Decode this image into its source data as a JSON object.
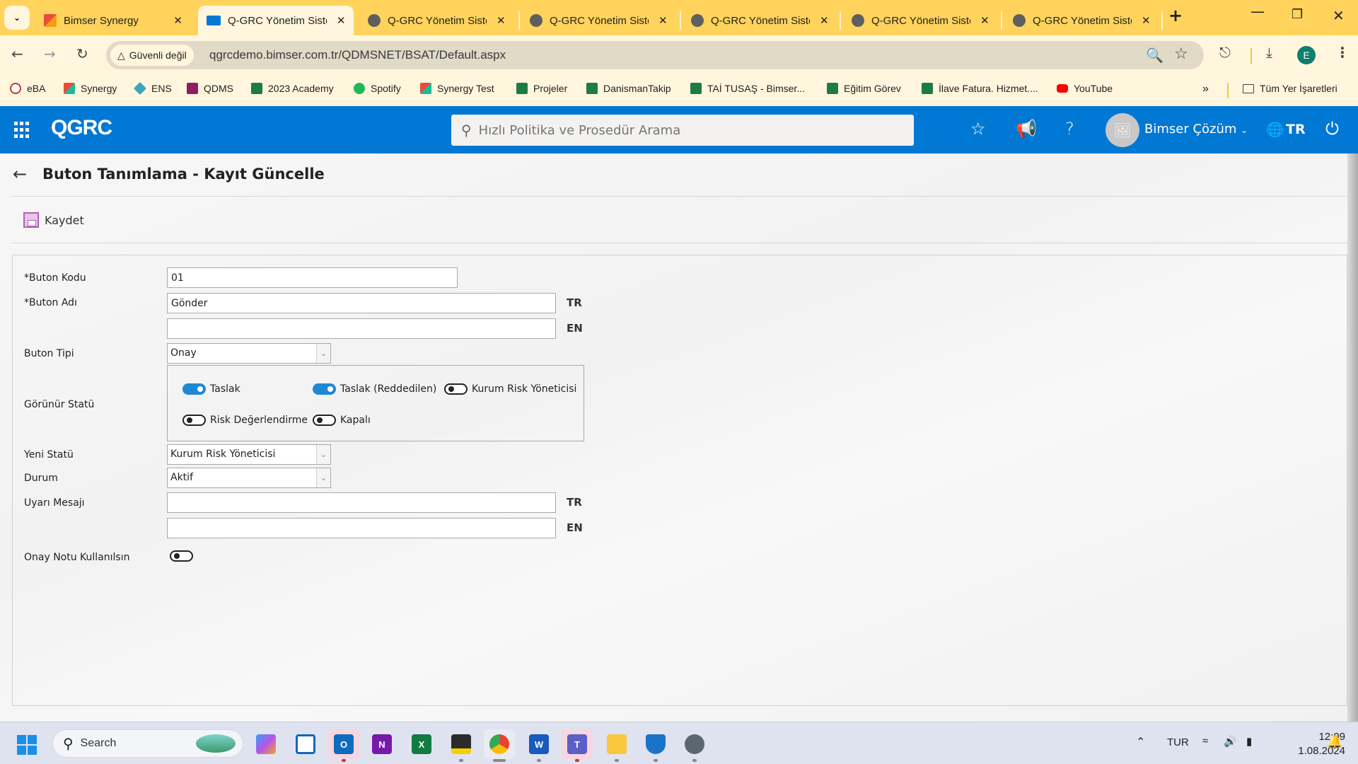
{
  "browser": {
    "tabs": [
      {
        "title": "Bimser Synergy",
        "active": false
      },
      {
        "title": "Q-GRC Yönetim Sistemi",
        "active": true
      },
      {
        "title": "Q-GRC Yönetim Sistemi",
        "active": false
      },
      {
        "title": "Q-GRC Yönetim Sistemi",
        "active": false
      },
      {
        "title": "Q-GRC Yönetim Sistemi",
        "active": false
      },
      {
        "title": "Q-GRC Yönetim Sistemi",
        "active": false
      },
      {
        "title": "Q-GRC Yönetim Sistemi",
        "active": false
      }
    ],
    "security_label": "Güvenli değil",
    "url": "qgrcdemo.bimser.com.tr/QDMSNET/BSAT/Default.aspx",
    "profile_initial": "E",
    "bookmarks": [
      {
        "label": "eBA",
        "color": "#c0392b"
      },
      {
        "label": "Synergy",
        "color": "#e67e22"
      },
      {
        "label": "ENS",
        "color": "#3aa6b9"
      },
      {
        "label": "QDMS",
        "color": "#8e1e5f"
      },
      {
        "label": "2023 Academy",
        "color": "#1d7c43"
      },
      {
        "label": "Spotify",
        "color": "#1db954"
      },
      {
        "label": "Synergy Test",
        "color": "#e67e22"
      },
      {
        "label": "Projeler",
        "color": "#1d7c43"
      },
      {
        "label": "DanismanTakip",
        "color": "#1d7c43"
      },
      {
        "label": "TAİ TUSAŞ - Bimser...",
        "color": "#1d7c43"
      },
      {
        "label": "Eğitim Görev",
        "color": "#1d7c43"
      },
      {
        "label": "İlave Fatura. Hizmet....",
        "color": "#1d7c43"
      },
      {
        "label": "YouTube",
        "color": "#ff0000"
      }
    ],
    "all_bookmarks_label": "Tüm Yer İşaretleri"
  },
  "app": {
    "logo": "QGRC",
    "search_placeholder": "Hızlı Politika ve Prosedür Arama",
    "user_name": "Bimser Çözüm",
    "language": "TR",
    "brand_color": "#0078d4"
  },
  "page": {
    "title": "Buton Tanımlama - Kayıt Güncelle",
    "save_label": "Kaydet"
  },
  "form": {
    "button_code": {
      "label": "*Buton Kodu",
      "value": "01"
    },
    "button_name": {
      "label": "*Buton Adı",
      "value_tr": "Gönder",
      "value_en": "",
      "lang_tr": "TR",
      "lang_en": "EN"
    },
    "button_type": {
      "label": "Buton Tipi",
      "value": "Onay"
    },
    "visible_status": {
      "label": "Görünür Statü",
      "options": [
        {
          "label": "Taslak",
          "on": true
        },
        {
          "label": "Taslak (Reddedilen)",
          "on": true
        },
        {
          "label": "Kurum Risk Yöneticisi",
          "on": false
        },
        {
          "label": "Risk Değerlendirme",
          "on": false
        },
        {
          "label": "Kapalı",
          "on": false
        }
      ]
    },
    "new_status": {
      "label": "Yeni Statü",
      "value": "Kurum Risk Yöneticisi"
    },
    "state": {
      "label": "Durum",
      "value": "Aktif"
    },
    "warning_message": {
      "label": "Uyarı Mesajı",
      "value_tr": "",
      "value_en": "",
      "lang_tr": "TR",
      "lang_en": "EN"
    },
    "use_approval_note": {
      "label": "Onay Notu Kullanılsın",
      "on": false
    }
  },
  "taskbar": {
    "search_label": "Search",
    "apps": [
      "copilot",
      "widgets",
      "outlook",
      "onenote",
      "excel",
      "sticky-notes",
      "chrome",
      "word",
      "teams",
      "file-explorer",
      "defender",
      "settings"
    ],
    "language": "TUR",
    "time": "12:09",
    "date": "1.08.2024"
  }
}
